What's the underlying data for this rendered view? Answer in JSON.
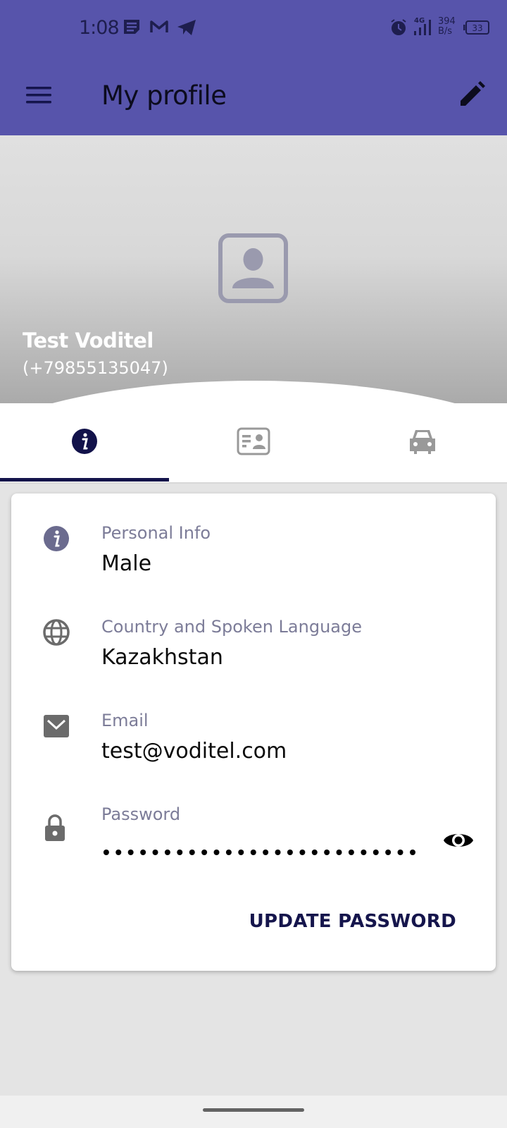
{
  "status_bar": {
    "time": "1:08",
    "notification_icons": [
      "notes-icon",
      "gmail-icon",
      "telegram-icon"
    ],
    "right_icons": [
      "alarm-icon",
      "signal-4g-icon",
      "battery-icon"
    ],
    "network_type": "4G",
    "data_speed_value": "394",
    "data_speed_unit": "B/s",
    "battery_level": "33"
  },
  "app_bar": {
    "title": "My profile",
    "menu_icon": "hamburger-menu-icon",
    "edit_icon": "pencil-edit-icon"
  },
  "profile": {
    "name": "Test Voditel",
    "phone": "(+79855135047)",
    "avatar_icon": "contact-portrait-icon"
  },
  "tabs": [
    {
      "icon": "info-icon",
      "active": true
    },
    {
      "icon": "id-card-icon",
      "active": false
    },
    {
      "icon": "car-icon",
      "active": false
    }
  ],
  "info_rows": [
    {
      "icon": "info-icon",
      "label": "Personal Info",
      "value": "Male"
    },
    {
      "icon": "globe-icon",
      "label": "Country and Spoken Language",
      "value": "Kazakhstan"
    },
    {
      "icon": "email-icon",
      "label": "Email",
      "value": "test@voditel.com"
    },
    {
      "icon": "lock-icon",
      "label": "Password",
      "value": "••••••••••••••••••••••••••"
    }
  ],
  "update_password_label": "UPDATE PASSWORD",
  "colors": {
    "primary": "#5754ab",
    "accent_dark": "#12124a",
    "label_gray": "#7c7c98",
    "icon_gray": "#6b6b6b"
  }
}
